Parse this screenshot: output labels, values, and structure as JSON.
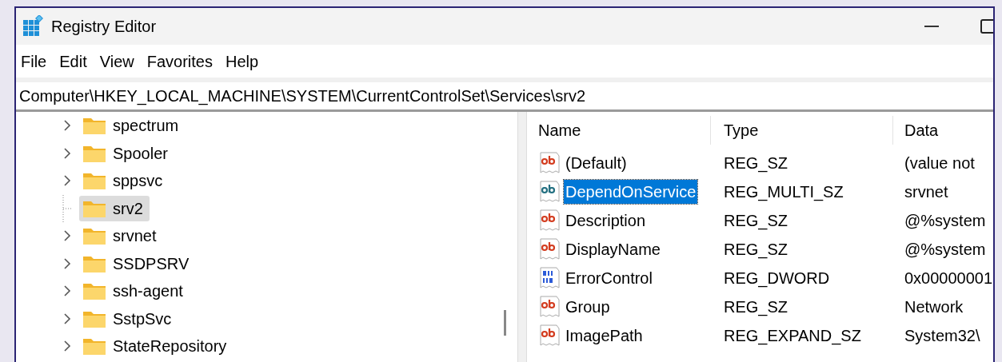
{
  "window": {
    "title": "Registry Editor"
  },
  "menu": [
    "File",
    "Edit",
    "View",
    "Favorites",
    "Help"
  ],
  "address": "Computer\\HKEY_LOCAL_MACHINE\\SYSTEM\\CurrentControlSet\\Services\\srv2",
  "tree": [
    {
      "label": "spectrum",
      "expandable": true,
      "selected": false
    },
    {
      "label": "Spooler",
      "expandable": true,
      "selected": false
    },
    {
      "label": "sppsvc",
      "expandable": true,
      "selected": false
    },
    {
      "label": "srv2",
      "expandable": false,
      "selected": true
    },
    {
      "label": "srvnet",
      "expandable": true,
      "selected": false
    },
    {
      "label": "SSDPSRV",
      "expandable": true,
      "selected": false
    },
    {
      "label": "ssh-agent",
      "expandable": true,
      "selected": false
    },
    {
      "label": "SstpSvc",
      "expandable": true,
      "selected": false
    },
    {
      "label": "StateRepository",
      "expandable": true,
      "selected": false
    }
  ],
  "table": {
    "columns": [
      "Name",
      "Type",
      "Data"
    ],
    "rows": [
      {
        "kind": "string",
        "name": "(Default)",
        "type": "REG_SZ",
        "data": "(value not",
        "selected": false
      },
      {
        "kind": "string",
        "name": "DependOnService",
        "type": "REG_MULTI_SZ",
        "data": "srvnet",
        "selected": true
      },
      {
        "kind": "string",
        "name": "Description",
        "type": "REG_SZ",
        "data": "@%system",
        "selected": false
      },
      {
        "kind": "string",
        "name": "DisplayName",
        "type": "REG_SZ",
        "data": "@%system",
        "selected": false
      },
      {
        "kind": "binary",
        "name": "ErrorControl",
        "type": "REG_DWORD",
        "data": "0x00000001",
        "selected": false
      },
      {
        "kind": "string",
        "name": "Group",
        "type": "REG_SZ",
        "data": "Network",
        "selected": false
      },
      {
        "kind": "string",
        "name": "ImagePath",
        "type": "REG_EXPAND_SZ",
        "data": "System32\\",
        "selected": false
      }
    ]
  }
}
